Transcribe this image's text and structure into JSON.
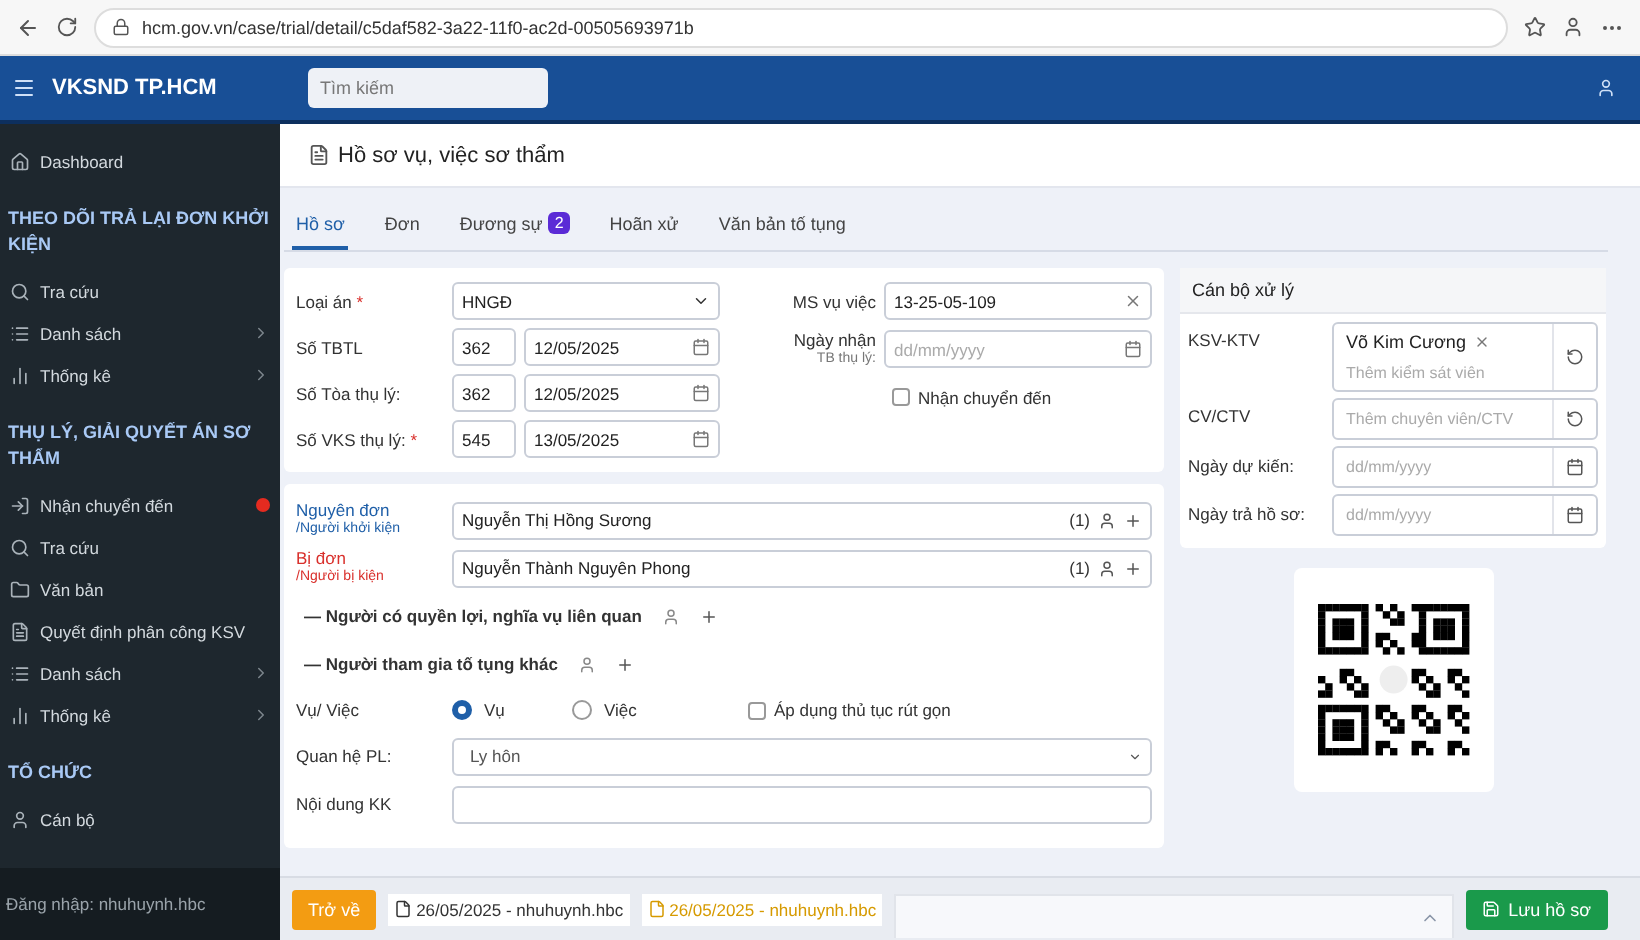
{
  "browser": {
    "url": "hcm.gov.vn/case/trial/detail/c5daf582-3a22-11f0-ac2d-00505693971b"
  },
  "header": {
    "title": "VKSND TP.HCM",
    "search_placeholder": "Tìm kiếm"
  },
  "sidebar": {
    "items": [
      {
        "kind": "item",
        "label": "Dashboard",
        "submenu": false,
        "alert": false
      },
      {
        "kind": "section",
        "label": "THEO DÕI TRẢ LẠI ĐƠN KHỞI KIỆN"
      },
      {
        "kind": "item",
        "label": "Tra cứu",
        "submenu": false,
        "alert": false
      },
      {
        "kind": "item",
        "label": "Danh sách",
        "submenu": true,
        "alert": false
      },
      {
        "kind": "item",
        "label": "Thống kê",
        "submenu": true,
        "alert": false
      },
      {
        "kind": "section",
        "label": "THỤ LÝ, GIẢI QUYẾT ÁN SƠ THẨM"
      },
      {
        "kind": "item",
        "label": "Nhận chuyển đến",
        "submenu": false,
        "alert": true
      },
      {
        "kind": "item",
        "label": "Tra cứu",
        "submenu": false,
        "alert": false
      },
      {
        "kind": "item",
        "label": "Văn bản",
        "submenu": false,
        "alert": false
      },
      {
        "kind": "item",
        "label": "Quyết định phân công KSV",
        "submenu": false,
        "alert": false
      },
      {
        "kind": "item",
        "label": "Danh sách",
        "submenu": true,
        "alert": false
      },
      {
        "kind": "item",
        "label": "Thống kê",
        "submenu": true,
        "alert": false
      },
      {
        "kind": "section",
        "label": "TỔ CHỨC"
      },
      {
        "kind": "item",
        "label": "Cán bộ",
        "submenu": false,
        "alert": false
      }
    ],
    "login": "Đăng nhập: nhuhuynh.hbc"
  },
  "page_title": "Hồ sơ vụ, việc sơ thẩm",
  "tabs": [
    {
      "label": "Hồ sơ",
      "selected": true
    },
    {
      "label": "Đơn",
      "selected": false
    },
    {
      "label": "Đương sự",
      "selected": false,
      "badge": "2"
    },
    {
      "label": "Hoãn xử",
      "selected": false
    },
    {
      "label": "Văn bản tố tụng",
      "selected": false
    }
  ],
  "case_form": {
    "case_type": {
      "label": "Loại án",
      "required_mark": "*",
      "value": "HNGĐ"
    },
    "numbers": [
      {
        "label": "Số TBTL",
        "number": "362",
        "date": "12/05/2025"
      },
      {
        "label": "Số Tòa thụ lý:",
        "number": "362",
        "date": "12/05/2025"
      },
      {
        "label": "Số VKS thụ lý:",
        "required_mark": "*",
        "number": "545",
        "date": "13/05/2025"
      }
    ],
    "case_code": {
      "label": "MS vụ việc",
      "value": "13-25-05-109"
    },
    "received_date": {
      "label": "Ngày nhận",
      "sublabel": "TB thụ lý:",
      "placeholder": "dd/mm/yyyy"
    },
    "transfer": {
      "label": "Nhận chuyển đến",
      "checked": false
    }
  },
  "parties": [
    {
      "role": "Nguyên đơn",
      "sub": "/Người khởi kiện",
      "color": "#1f5fa8",
      "name": "Nguyễn Thị Hồng Sương",
      "count": "(1)"
    },
    {
      "role": "Bị đơn",
      "sub": "/Người bị kiện",
      "color": "#d9302c",
      "name": "Nguyễn Thành Nguyên Phong",
      "count": "(1)"
    }
  ],
  "groups": [
    "— Người có quyền lợi, nghĩa vụ liên quan",
    "— Người tham gia tố tụng khác"
  ],
  "case_kind": {
    "label": "Vụ/ Việc",
    "options": [
      {
        "label": "Vụ",
        "selected": true
      },
      {
        "label": "Việc",
        "selected": false
      }
    ],
    "shortened": {
      "label": "Áp dụng thủ tục rút gọn",
      "checked": false
    }
  },
  "relation": {
    "label": "Quan hệ PL:",
    "value": "Ly hôn"
  },
  "claim": {
    "label": "Nội dung KK"
  },
  "officers": {
    "title": "Cán bộ xử lý",
    "ksv": {
      "label": "KSV-KTV",
      "tags": [
        "Võ Kim Cương"
      ],
      "placeholder": "Thêm kiểm sát viên"
    },
    "cv": {
      "label": "CV/CTV",
      "placeholder": "Thêm chuyên viên/CTV"
    },
    "dates": [
      {
        "label": "Ngày dự kiến:",
        "placeholder": "dd/mm/yyyy"
      },
      {
        "label": "Ngày trả hồ sơ:",
        "placeholder": "dd/mm/yyyy"
      }
    ]
  },
  "footer": {
    "back": "Trở về",
    "files": [
      {
        "label": "26/05/2025 - nhuhuynh.hbc",
        "kind": "plain"
      },
      {
        "label": "26/05/2025 - nhuhuynh.hbc",
        "kind": "highlight"
      }
    ],
    "save": "Lưu hồ sơ"
  }
}
